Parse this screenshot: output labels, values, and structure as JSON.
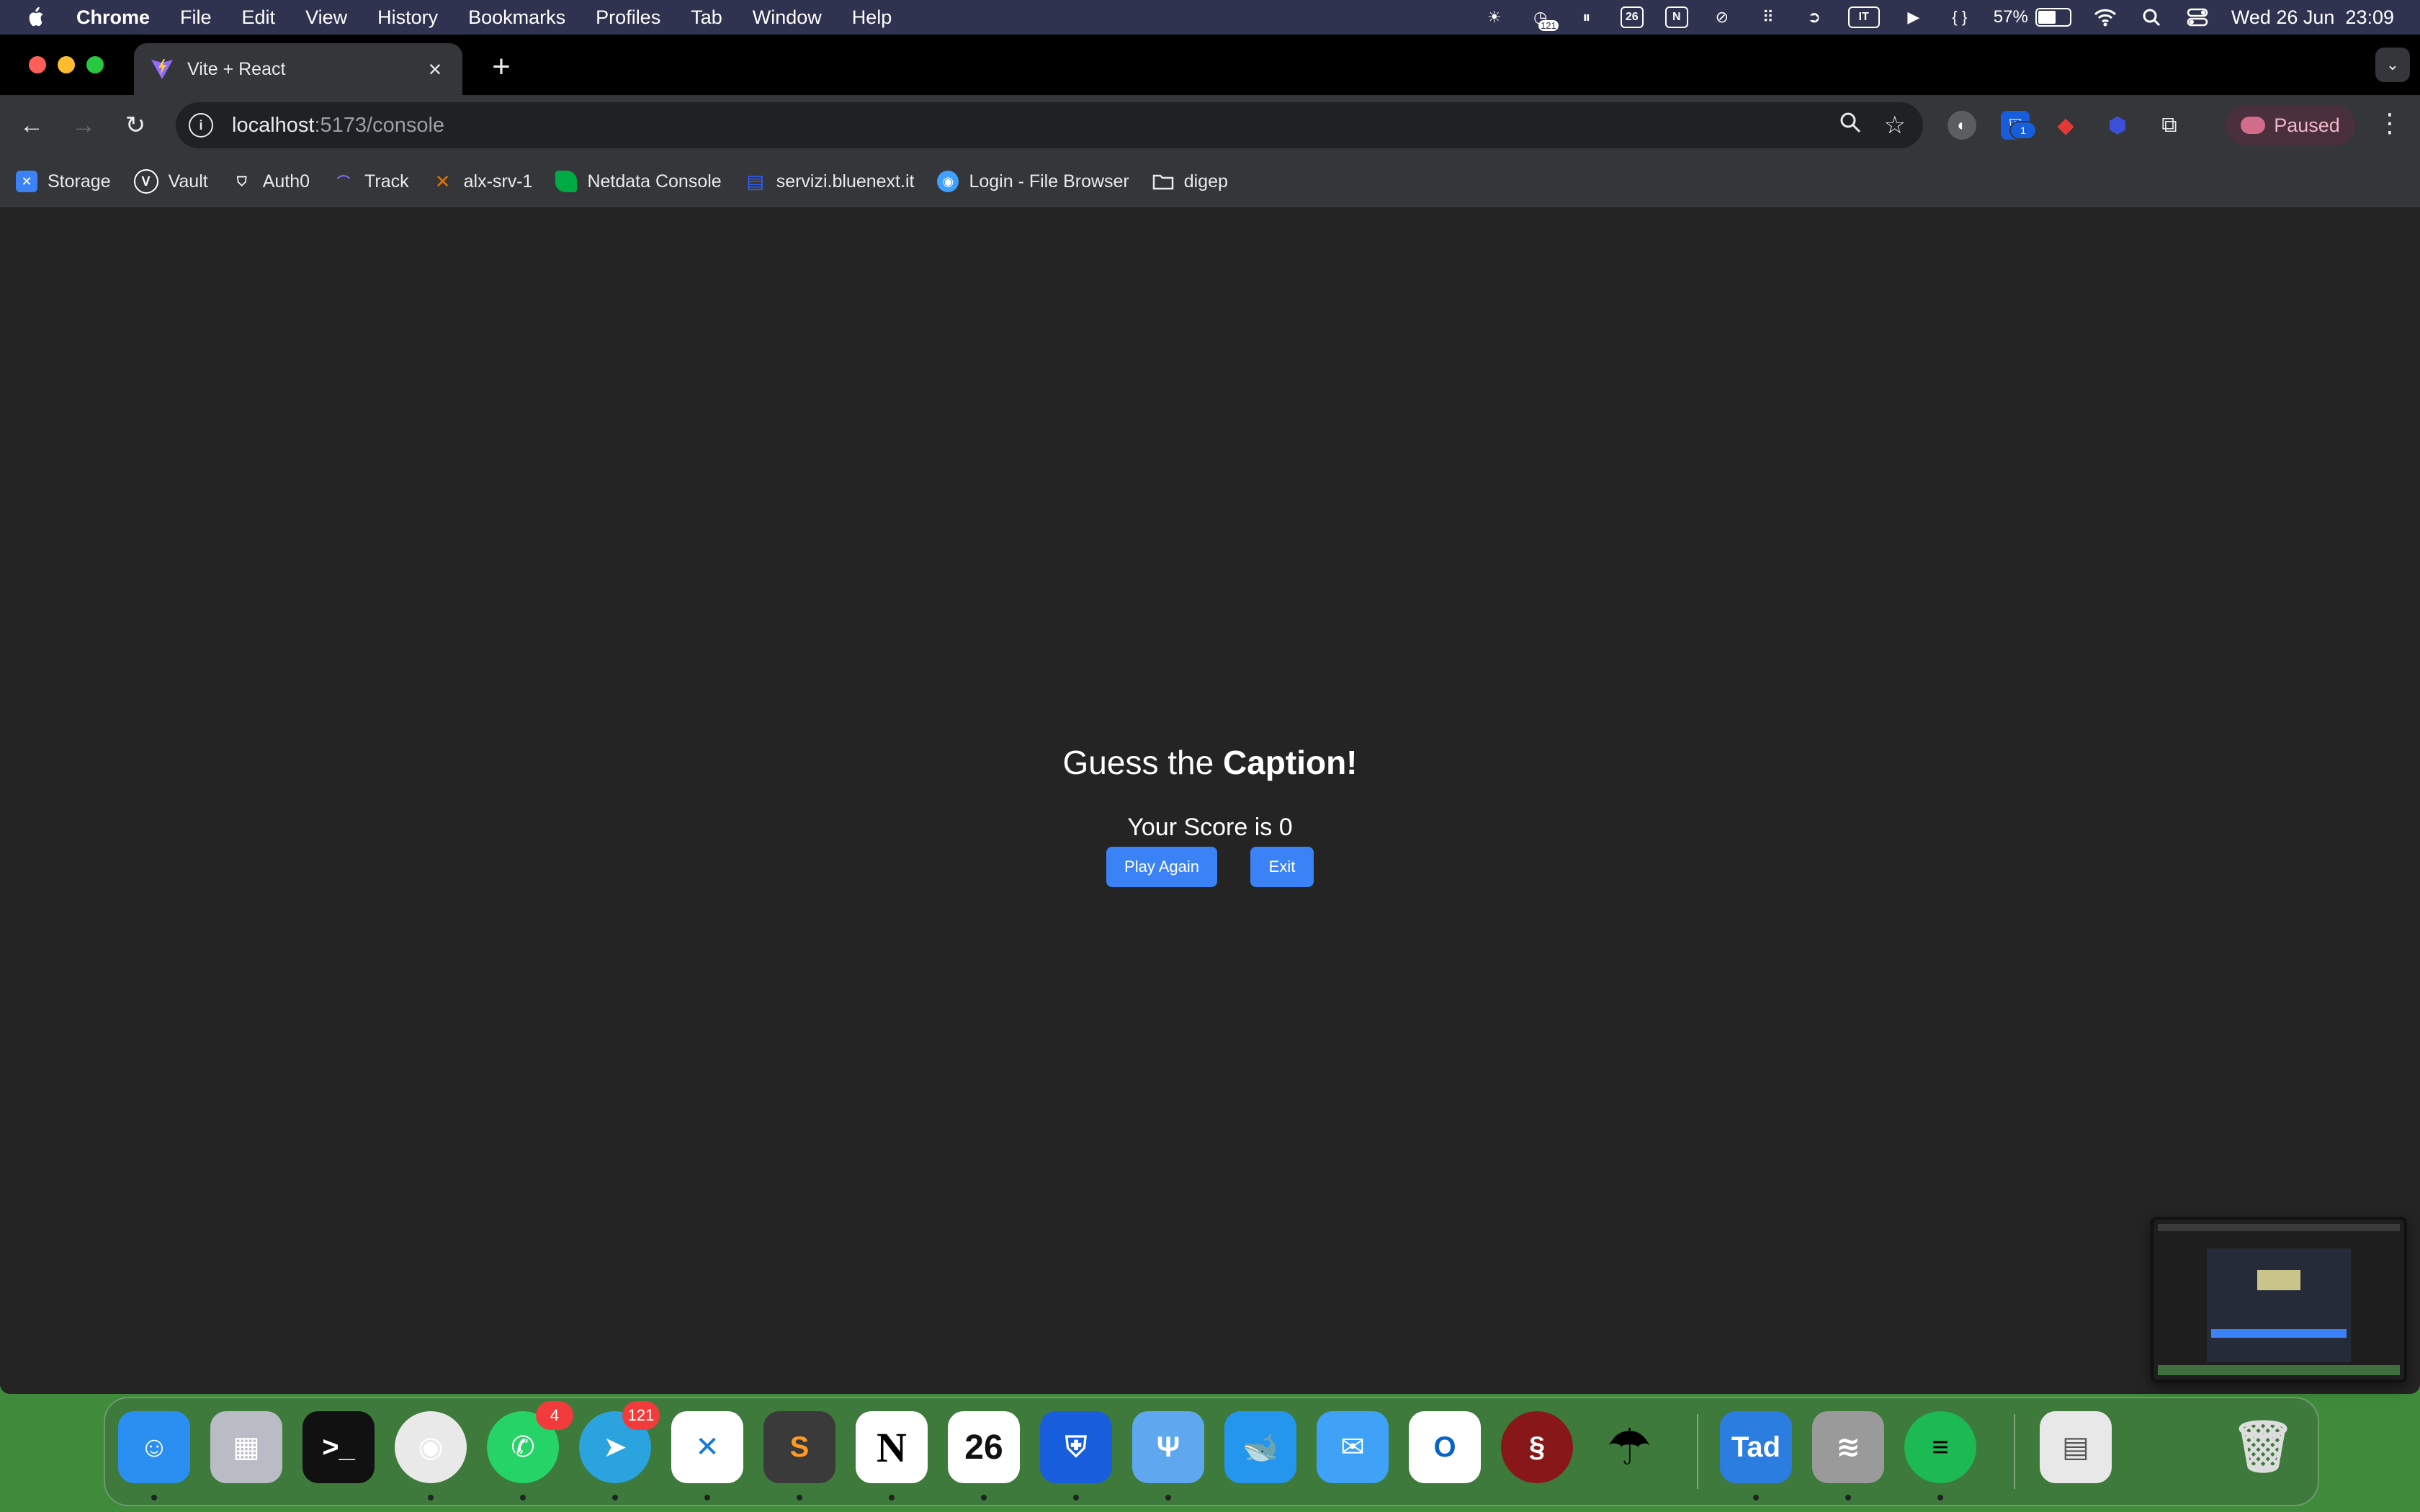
{
  "menubar": {
    "app": "Chrome",
    "items": [
      "File",
      "Edit",
      "View",
      "History",
      "Bookmarks",
      "Profiles",
      "Tab",
      "Window",
      "Help"
    ],
    "status": {
      "calendar_badge": "121",
      "calendar_day": "26",
      "keyboard": "IT",
      "braces": "{ }",
      "battery": "57%",
      "datetime": "Wed 26 Jun  23:09"
    }
  },
  "browser": {
    "tab_title": "Vite + React",
    "url_host": "localhost",
    "url_path": ":5173/console",
    "profile_label": "Paused",
    "extension_badge": "1"
  },
  "bookmarks": [
    {
      "label": "Storage",
      "icon": "storage-icon",
      "color": "#3b82f6"
    },
    {
      "label": "Vault",
      "icon": "vault-icon",
      "color": "#444"
    },
    {
      "label": "Auth0",
      "icon": "auth0-icon",
      "color": "#222"
    },
    {
      "label": "Track",
      "icon": "track-icon",
      "color": "#5a4fc4"
    },
    {
      "label": "alx-srv-1",
      "icon": "proxmox-icon",
      "color": "#e57000"
    },
    {
      "label": "Netdata Console",
      "icon": "netdata-icon",
      "color": "#00ab44"
    },
    {
      "label": "servizi.bluenext.it",
      "icon": "document-icon",
      "color": "#2f5fff"
    },
    {
      "label": "Login - File Browser",
      "icon": "filebrowser-icon",
      "color": "#40a0ff"
    },
    {
      "label": "digep",
      "icon": "folder-icon",
      "color": "transparent"
    }
  ],
  "game": {
    "title_prefix": "Guess the ",
    "title_bold": "Caption!",
    "score_text": "Your Score is 0",
    "play_again_label": "Play Again",
    "exit_label": "Exit"
  },
  "dock": {
    "apps": [
      {
        "name": "finder-icon",
        "glyph": "☺",
        "bg": "#2a8ff0"
      },
      {
        "name": "launchpad-icon",
        "glyph": "▦",
        "bg": "#b9bcc4"
      },
      {
        "name": "terminal-icon",
        "glyph": ">_",
        "bg": "#111111"
      },
      {
        "name": "chrome-icon",
        "glyph": "◉",
        "bg": "#e9e9e9"
      },
      {
        "name": "whatsapp-icon",
        "glyph": "✆",
        "bg": "#25d366",
        "badge": "4"
      },
      {
        "name": "telegram-icon",
        "glyph": "➤",
        "bg": "#2aa3df",
        "badge": "121"
      },
      {
        "name": "vscode-icon",
        "glyph": "✕",
        "bg": "#ffffff"
      },
      {
        "name": "sublime-icon",
        "glyph": "S",
        "bg": "#3a3a3a"
      },
      {
        "name": "notion-icon",
        "glyph": "N",
        "bg": "#ffffff"
      },
      {
        "name": "calendar-icon",
        "glyph": "26",
        "bg": "#ffffff"
      },
      {
        "name": "bitwarden-icon",
        "glyph": "⛨",
        "bg": "#175ddc"
      },
      {
        "name": "fork-icon",
        "glyph": "Ψ",
        "bg": "#5fa8f0"
      },
      {
        "name": "docker-icon",
        "glyph": "🐋",
        "bg": "#2496ed"
      },
      {
        "name": "mail-icon",
        "glyph": "✉",
        "bg": "#3fa2f7"
      },
      {
        "name": "outlook-icon",
        "glyph": "O",
        "bg": "#ffffff"
      },
      {
        "name": "wireguard-icon",
        "glyph": "§",
        "bg": "#88171a"
      },
      {
        "name": "umbrella-icon",
        "glyph": "☂",
        "bg": "transparent"
      },
      {
        "name": "tad-icon",
        "glyph": "Tad",
        "bg": "#2b7de0"
      },
      {
        "name": "database-icon",
        "glyph": "≋",
        "bg": "#9a9a9a"
      },
      {
        "name": "spotify-icon",
        "glyph": "≡",
        "bg": "#1db954"
      },
      {
        "name": "document-stack-icon",
        "glyph": "▤",
        "bg": "#e8e8e8"
      },
      {
        "name": "trash-icon",
        "glyph": "🗑",
        "bg": "transparent"
      }
    ]
  }
}
